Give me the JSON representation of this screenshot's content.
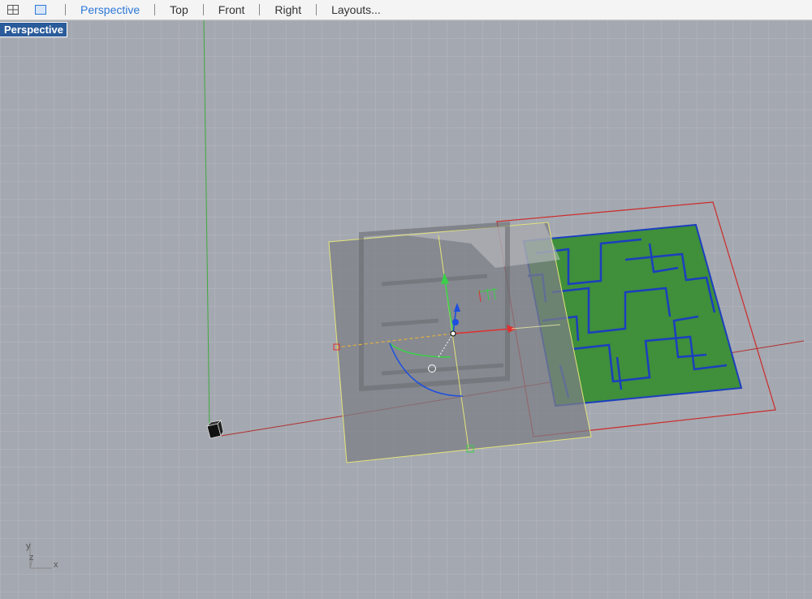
{
  "toolbar": {
    "tabs": [
      {
        "label": "Perspective",
        "active": true
      },
      {
        "label": "Top",
        "active": false
      },
      {
        "label": "Front",
        "active": false
      },
      {
        "label": "Right",
        "active": false
      },
      {
        "label": "Layouts...",
        "active": false
      }
    ],
    "icons": [
      "four-viewports-icon",
      "single-viewport-icon"
    ]
  },
  "viewport": {
    "label": "Perspective",
    "axis_labels": {
      "y": "y",
      "z": "z",
      "x": "x"
    }
  },
  "colors": {
    "grid_bg": "#a4a8b0",
    "grid_line": "#b6b9c0",
    "maze_fill": "#3f8f3b",
    "maze_outline": "#1b3fbf",
    "selection": "#cc2a2a",
    "gumball_x": "#e03030",
    "gumball_y": "#3bd04a",
    "gumball_z": "#1d4fe0",
    "active_tab": "#2c78d8"
  }
}
